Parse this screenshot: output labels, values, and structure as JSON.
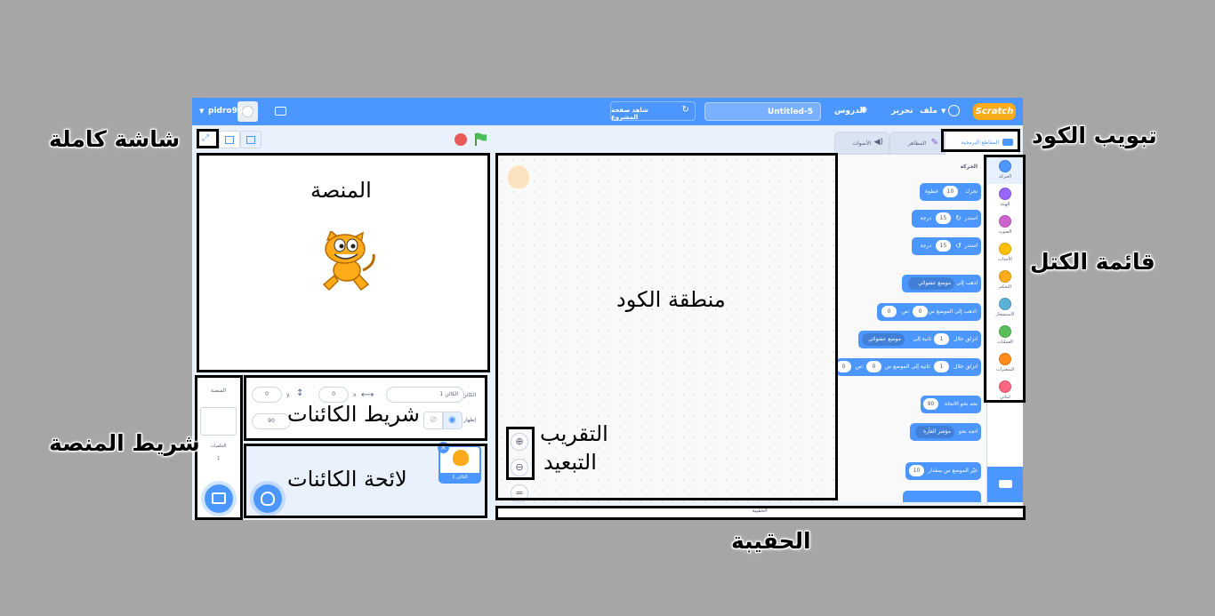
{
  "menubar": {
    "logo": "Scratch",
    "file": "ملف",
    "edit": "تحرير",
    "tutorials": "الدروس",
    "project_title": "Untitled-5",
    "see_project_page": "شاهد صفحة المشروع",
    "username": "pidro96"
  },
  "tabs": {
    "code": "المقاطع البرمجية",
    "costumes": "المظاهر",
    "sounds": "الأصوات"
  },
  "categories": [
    {
      "label": "الحركة",
      "color": "#4c97ff"
    },
    {
      "label": "الهيئة",
      "color": "#9966ff"
    },
    {
      "label": "الصوت",
      "color": "#cf63cf"
    },
    {
      "label": "الأحداث",
      "color": "#ffbf00"
    },
    {
      "label": "التحكم",
      "color": "#ffab19"
    },
    {
      "label": "الاستشعار",
      "color": "#5cb1d6"
    },
    {
      "label": "العمليات",
      "color": "#59c059"
    },
    {
      "label": "المتغيرات",
      "color": "#ff8c1a"
    },
    {
      "label": "لبناتي",
      "color": "#ff6680"
    }
  ],
  "palette": {
    "section_title": "الحركة",
    "blocks": {
      "move": {
        "text": "تحرك",
        "value": "10",
        "suffix": "خطوة"
      },
      "turn_right": {
        "text": "استدر",
        "value": "15",
        "suffix": "درجة"
      },
      "turn_left": {
        "text": "استدر",
        "value": "15",
        "suffix": "درجة"
      },
      "goto_random": {
        "text": "اذهب إلى",
        "dropdown": "موضع عشوائي"
      },
      "goto_xy": {
        "text": "اذهب إلى الموضع س:",
        "x": "0",
        "y_label": "ص:",
        "y": "0"
      },
      "glide_random": {
        "text": "انزلق خلال",
        "value": "1",
        "mid": "ثانية إلى",
        "dropdown": "موضع عشوائي"
      },
      "glide_xy": {
        "text": "انزلق خلال",
        "value": "1",
        "mid": "ثانية إلى الموضع س:",
        "x": "0",
        "y_label": "ص:",
        "y": "0"
      },
      "point_direction": {
        "text": "تجه نحو الاتجاه",
        "value": "90"
      },
      "point_towards": {
        "text": "اتجه نحو",
        "dropdown": "مؤشر الفأرة"
      },
      "change_x": {
        "text": "غيّر الموضع س بمقدار",
        "value": "10"
      }
    }
  },
  "sprite_info": {
    "sprite_label": "الكائن",
    "sprite_name": "الكائن 1",
    "x_label": "x",
    "x_value": "0",
    "y_label": "y",
    "y_value": "0",
    "show_label": "إظهار",
    "direction_value": "90"
  },
  "sprite_list": {
    "sprite_name": "الكائن 1"
  },
  "stage_pane": {
    "title": "المنصة",
    "backdrops_label": "الخلفيات",
    "backdrops_count": "1"
  },
  "backpack": {
    "label": "الحقيبة"
  },
  "annotations": {
    "fullscreen": "شاشة كاملة",
    "code_tab": "تبويب الكود",
    "stage": "المنصة",
    "code_area": "منطقة الكود",
    "block_list": "قائمة الكتل",
    "sprite_bar": "شريط الكائنات",
    "stage_bar": "شريط المنصة",
    "sprite_list": "لائحة الكائنات",
    "zoom_in": "التقريب",
    "zoom_out": "التبعيد",
    "backpack": "الحقيبة"
  },
  "colors": {
    "menubar": "#4c97ff",
    "page_bg": "#a6a6a6",
    "app_bg": "#e9f1fc",
    "motion": "#4c97ff"
  }
}
